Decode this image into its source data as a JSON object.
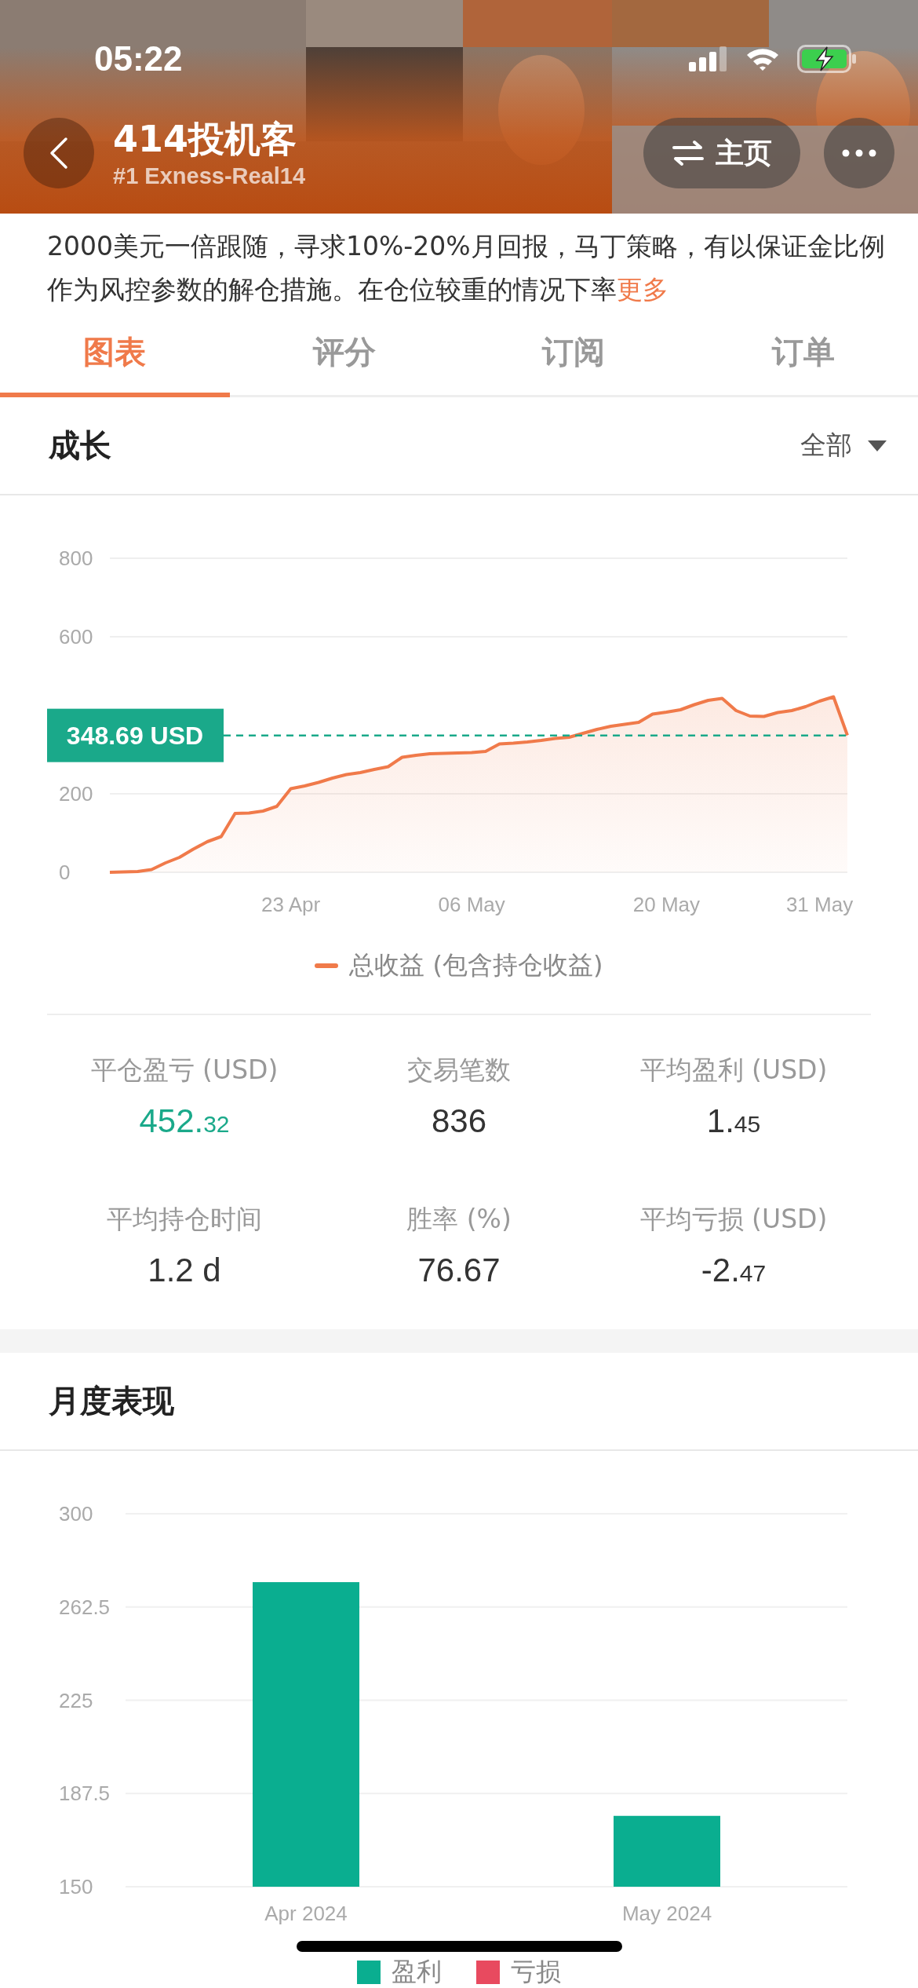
{
  "status_bar": {
    "time": "05:22"
  },
  "header": {
    "title": "414投机客",
    "subtitle": "#1 Exness-Real14",
    "home_button": "主页"
  },
  "description": {
    "text": "2000美元一倍跟随，寻求10%-20%月回报，马丁策略，有以保证金比例作为风控参数的解仓措施。在仓位较重的情况下率",
    "more": "更多"
  },
  "tabs": [
    {
      "label": "图表",
      "selected": true
    },
    {
      "label": "评分",
      "selected": false
    },
    {
      "label": "订阅",
      "selected": false
    },
    {
      "label": "订单",
      "selected": false
    }
  ],
  "growth": {
    "title": "成长",
    "filter": "全部",
    "chart_data": {
      "type": "area",
      "categories": [
        null,
        null,
        null,
        null,
        null,
        null,
        null,
        null,
        null,
        null,
        null,
        null,
        null,
        "23 Apr",
        null,
        null,
        null,
        null,
        null,
        null,
        null,
        null,
        null,
        null,
        null,
        null,
        "06 May",
        null,
        null,
        null,
        null,
        null,
        null,
        null,
        null,
        null,
        null,
        null,
        null,
        null,
        "20 May",
        null,
        null,
        null,
        null,
        null,
        null,
        null,
        null,
        null,
        null,
        "31 May",
        null,
        null
      ],
      "series": [
        {
          "name": "总收益 (包含持仓收益)",
          "color": "#f07a4a",
          "values": [
            0,
            1,
            2,
            7,
            24,
            38,
            59,
            78,
            91,
            150,
            151,
            156,
            168,
            213,
            220,
            229,
            240,
            249,
            254,
            262,
            269,
            293,
            298,
            302,
            303,
            304,
            305,
            308,
            327,
            329,
            332,
            336,
            341,
            344,
            354,
            364,
            372,
            377,
            382,
            403,
            408,
            414,
            427,
            438,
            443,
            412,
            398,
            397,
            407,
            412,
            422,
            436,
            447,
            349
          ]
        }
      ],
      "ylim": [
        0,
        800
      ],
      "yticks": [
        0,
        200,
        600,
        800
      ],
      "grid": true,
      "ref_lines": [
        {
          "axis": "y",
          "value": 348.69,
          "label": "348.69 USD",
          "color": "#1aa98a"
        }
      ]
    },
    "stats": [
      {
        "label": "平仓盈亏 (USD)",
        "value": "452.32",
        "kind": "money",
        "emphasized": true
      },
      {
        "label": "交易笔数",
        "value": "836",
        "kind": "plain",
        "emphasized": false
      },
      {
        "label": "平均盈利 (USD)",
        "value": "1.45",
        "kind": "money",
        "emphasized": false
      },
      {
        "label": "平均持仓时间",
        "value": "1.2 d",
        "kind": "plain",
        "emphasized": false
      },
      {
        "label": "胜率 (%)",
        "value": "76.67",
        "kind": "plain",
        "emphasized": false
      },
      {
        "label": "平均亏损 (USD)",
        "value": "-2.47",
        "kind": "money",
        "emphasized": false
      }
    ]
  },
  "monthly": {
    "title": "月度表现",
    "chart_data": {
      "type": "bar",
      "categories": [
        "Apr 2024",
        "May 2024"
      ],
      "series": [
        {
          "name": "盈利",
          "color": "#0aae90",
          "values": [
            272.5,
            178.5
          ]
        },
        {
          "name": "亏损",
          "color": "#e84a5f",
          "values": [
            null,
            null
          ]
        }
      ],
      "ylim": [
        150,
        300
      ],
      "yticks": [
        150,
        187.5,
        225,
        262.5,
        300
      ],
      "grid": true
    }
  }
}
